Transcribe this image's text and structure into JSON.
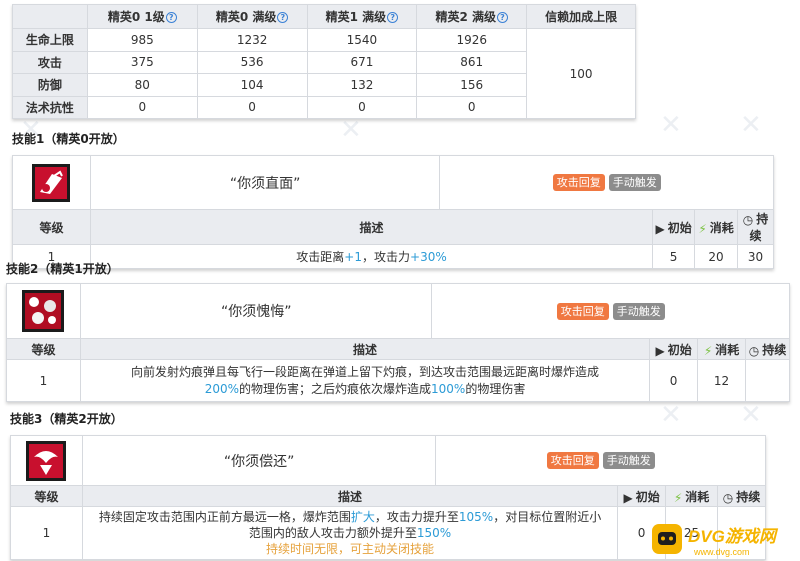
{
  "stats": {
    "headers": [
      "",
      "精英0 1级",
      "精英0 满级",
      "精英1 满级",
      "精英2 满级",
      "信赖加成上限"
    ],
    "rows": [
      {
        "label": "生命上限",
        "values": [
          "985",
          "1232",
          "1540",
          "1926"
        ],
        "trust": ""
      },
      {
        "label": "攻击",
        "values": [
          "375",
          "536",
          "671",
          "861"
        ],
        "trust": "100"
      },
      {
        "label": "防御",
        "values": [
          "80",
          "104",
          "132",
          "156"
        ],
        "trust": ""
      },
      {
        "label": "法术抗性",
        "values": [
          "0",
          "0",
          "0",
          "0"
        ],
        "trust": ""
      }
    ]
  },
  "skills": [
    {
      "title": "技能1（精英0开放）",
      "name": "“你须直面”",
      "tags": [
        "攻击回复",
        "手动触发"
      ],
      "headers": {
        "level": "等级",
        "desc": "描述",
        "init": "初始",
        "cost": "消耗",
        "dur": "持续"
      },
      "row": {
        "level": "1",
        "desc_parts": [
          "攻击距离",
          "+1",
          "，攻击力",
          "+30%"
        ],
        "init": "5",
        "cost": "20",
        "dur": "30"
      }
    },
    {
      "title": "技能2（精英1开放）",
      "name": "“你须愧悔”",
      "tags": [
        "攻击回复",
        "手动触发"
      ],
      "headers": {
        "level": "等级",
        "desc": "描述",
        "init": "初始",
        "cost": "消耗",
        "dur": "持续"
      },
      "row": {
        "level": "1",
        "desc_parts": [
          "向前发射灼痕弹且每飞行一段距离在弹道上留下灼痕，到达攻击范围最远距离时爆炸造成",
          "200%",
          "的物理伤害；之后灼痕依次爆炸造成",
          "100%",
          "的物理伤害"
        ],
        "init": "0",
        "cost": "12",
        "dur": ""
      }
    },
    {
      "title": "技能3（精英2开放）",
      "name": "“你须偿还”",
      "tags": [
        "攻击回复",
        "手动触发"
      ],
      "headers": {
        "level": "等级",
        "desc": "描述",
        "init": "初始",
        "cost": "消耗",
        "dur": "持续"
      },
      "row": {
        "level": "1",
        "desc_parts": [
          "持续固定攻击范围内正前方最远一格，爆炸范围",
          "扩大",
          "，攻击力提升至",
          "105%",
          "，对目标位置附近小范围内的敌人攻击力额外提升至",
          "150%"
        ],
        "note": "持续时间无限，可主动关闭技能",
        "init": "0",
        "cost": "25",
        "dur": ""
      }
    }
  ],
  "watermark": {
    "text": "DVG游戏网",
    "url": "www.dvg.com"
  },
  "colors": {
    "header_bg": "#eaecf0",
    "tag_orange": "#f07841",
    "tag_gray": "#8c8c8c",
    "highlight": "#2c9bd6",
    "note": "#e6a23c",
    "icon_red": "#c8102e"
  }
}
